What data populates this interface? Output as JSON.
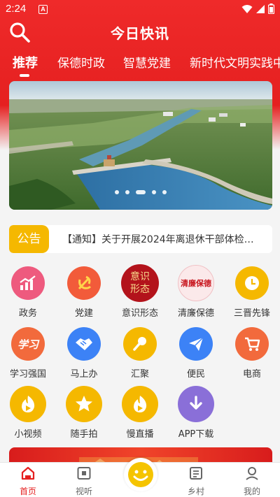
{
  "status_bar": {
    "time": "2:24",
    "notif_letter": "A"
  },
  "header": {
    "title": "今日快讯",
    "search_icon": "search-icon"
  },
  "tabs": [
    {
      "label": "推荐",
      "active": true
    },
    {
      "label": "保德时政",
      "active": false
    },
    {
      "label": "智慧党建",
      "active": false
    },
    {
      "label": "新时代文明实践中心",
      "active": false
    }
  ],
  "carousel": {
    "slides": 5,
    "current": 3
  },
  "notice": {
    "tag": "公告",
    "text": "【通知】关于开展2024年离退休干部体检…"
  },
  "services": [
    {
      "label": "政务",
      "icon": "chart-icon",
      "color": "#ee5a7e"
    },
    {
      "label": "党建",
      "icon": "party-emblem-icon",
      "color": "#f25b3a"
    },
    {
      "label": "意识形态",
      "icon": "ideology-badge-icon",
      "color": "#b3131b",
      "badge_text": [
        "意识",
        "形态"
      ]
    },
    {
      "label": "清廉保德",
      "icon": "clean-government-icon",
      "color": "#f7e1e3",
      "badge_text": [
        "清廉保德"
      ]
    },
    {
      "label": "三晋先锋",
      "icon": "clock-icon",
      "color": "#f5b800"
    },
    {
      "label": "学习强国",
      "icon": "study-icon",
      "color": "#f26a3c",
      "badge_text": [
        "学习"
      ]
    },
    {
      "label": "马上办",
      "icon": "handshake-icon",
      "color": "#3c82f6"
    },
    {
      "label": "汇聚",
      "icon": "microphone-icon",
      "color": "#f5b800"
    },
    {
      "label": "便民",
      "icon": "paper-plane-icon",
      "color": "#3c82f6"
    },
    {
      "label": "电商",
      "icon": "cart-icon",
      "color": "#f26a3c"
    },
    {
      "label": "小视频",
      "icon": "video-play-icon",
      "color": "#f5b800"
    },
    {
      "label": "随手拍",
      "icon": "star-icon",
      "color": "#f5b800"
    },
    {
      "label": "慢直播",
      "icon": "live-play-icon",
      "color": "#f5b800"
    },
    {
      "label": "APP下载",
      "icon": "download-icon",
      "color": "#8a6fd8"
    }
  ],
  "bottom_nav": [
    {
      "label": "首页",
      "icon": "home-icon",
      "active": true
    },
    {
      "label": "视听",
      "icon": "tv-icon",
      "active": false
    },
    {
      "label": "",
      "icon": "smiley-icon",
      "active": false
    },
    {
      "label": "乡村",
      "icon": "village-icon",
      "active": false
    },
    {
      "label": "我的",
      "icon": "profile-icon",
      "active": false
    }
  ],
  "colors": {
    "brand_red": "#e52020",
    "accent_yellow": "#f5b800"
  }
}
